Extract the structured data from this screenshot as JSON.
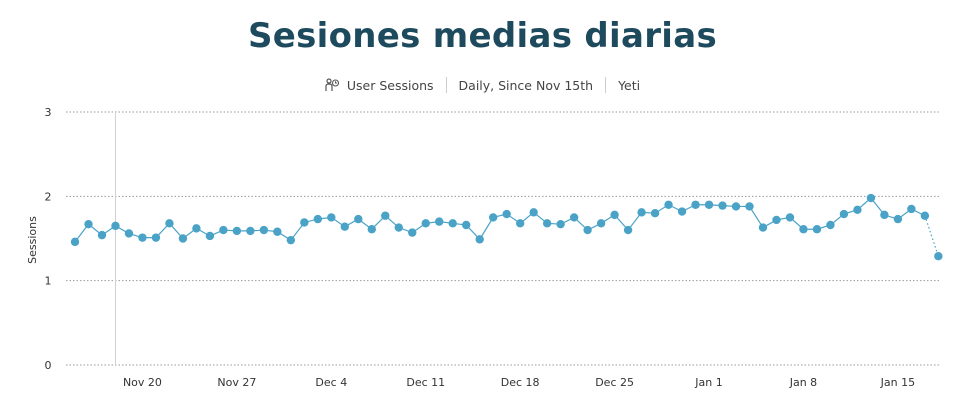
{
  "header": {
    "title": "Sesiones medias diarias",
    "metric": "User Sessions",
    "period": "Daily, Since Nov 15th",
    "site": "Yeti",
    "metric_icon": "user-sessions-icon"
  },
  "colors": {
    "line": "#4aa3c7",
    "point": "#4aa3c7",
    "title": "#1e4a5e"
  },
  "chart_data": {
    "type": "line",
    "ylabel": "Sessions",
    "ylim": [
      0,
      3
    ],
    "y_ticks": [
      0,
      1,
      2,
      3
    ],
    "x_start": "2017-11-15",
    "x_tick_labels": [
      "Nov 20",
      "Nov 27",
      "Dec 4",
      "Dec 11",
      "Dec 18",
      "Dec 25",
      "Jan 1",
      "Jan 8",
      "Jan 15"
    ],
    "x_tick_dates": [
      "2017-11-20",
      "2017-11-27",
      "2017-12-04",
      "2017-12-11",
      "2017-12-18",
      "2017-12-25",
      "2018-01-01",
      "2018-01-08",
      "2018-01-15"
    ],
    "marker_date": "2017-11-18",
    "grid": "horizontal-dotted",
    "series": [
      {
        "name": "",
        "values": [
          1.46,
          1.67,
          1.54,
          1.65,
          1.56,
          1.51,
          1.51,
          1.68,
          1.5,
          1.62,
          1.53,
          1.6,
          1.59,
          1.59,
          1.6,
          1.58,
          1.48,
          1.69,
          1.73,
          1.75,
          1.64,
          1.73,
          1.61,
          1.77,
          1.63,
          1.57,
          1.68,
          1.7,
          1.68,
          1.66,
          1.49,
          1.75,
          1.79,
          1.68,
          1.81,
          1.68,
          1.67,
          1.75,
          1.6,
          1.68,
          1.78,
          1.6,
          1.81,
          1.8,
          1.9,
          1.82,
          1.9,
          1.9,
          1.89,
          1.88,
          1.88,
          1.63,
          1.72,
          1.75,
          1.61,
          1.61,
          1.66,
          1.79,
          1.84,
          1.98,
          1.78,
          1.73,
          1.85,
          1.77,
          1.29
        ],
        "last_segment_style": "dotted"
      }
    ]
  }
}
